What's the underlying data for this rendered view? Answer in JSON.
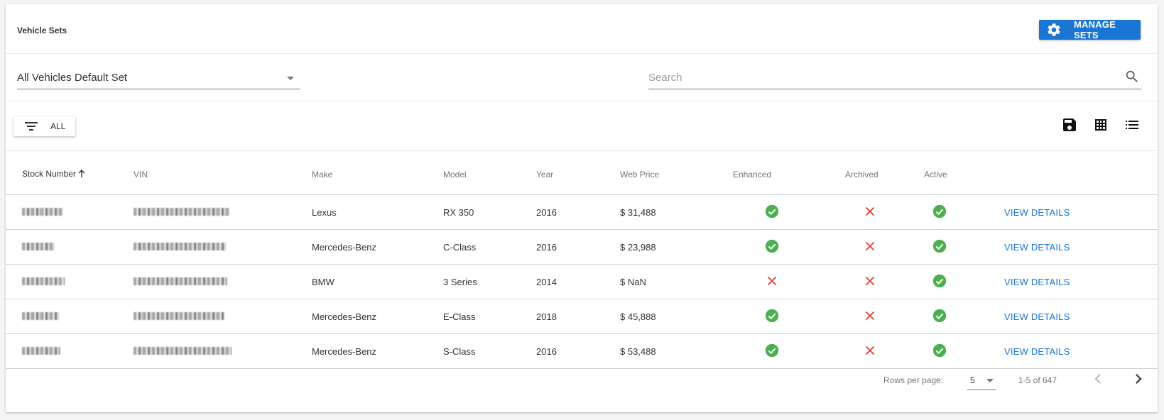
{
  "header": {
    "title": "Vehicle Sets",
    "manage_sets_label": "MANAGE SETS"
  },
  "controls": {
    "set_select_value": "All Vehicles Default Set",
    "search_placeholder": "Search",
    "filter_label": "ALL"
  },
  "table": {
    "columns": [
      "Stock Number",
      "VIN",
      "Make",
      "Model",
      "Year",
      "Web Price",
      "Enhanced",
      "Archived",
      "Active"
    ],
    "sort_column": "Stock Number",
    "sort_direction": "ascending",
    "rows": [
      {
        "make": "Lexus",
        "model": "RX 350",
        "year": "2016",
        "price": "$ 31,488",
        "enhanced": true,
        "archived": false,
        "active": true,
        "action": "VIEW DETAILS"
      },
      {
        "make": "Mercedes-Benz",
        "model": "C-Class",
        "year": "2016",
        "price": "$ 23,988",
        "enhanced": true,
        "archived": false,
        "active": true,
        "action": "VIEW DETAILS"
      },
      {
        "make": "BMW",
        "model": "3 Series",
        "year": "2014",
        "price": "$ NaN",
        "enhanced": false,
        "archived": false,
        "active": true,
        "action": "VIEW DETAILS"
      },
      {
        "make": "Mercedes-Benz",
        "model": "E-Class",
        "year": "2018",
        "price": "$ 45,888",
        "enhanced": true,
        "archived": false,
        "active": true,
        "action": "VIEW DETAILS"
      },
      {
        "make": "Mercedes-Benz",
        "model": "S-Class",
        "year": "2016",
        "price": "$ 53,488",
        "enhanced": true,
        "archived": false,
        "active": true,
        "action": "VIEW DETAILS"
      }
    ]
  },
  "pagination": {
    "rows_per_page_label": "Rows per page:",
    "rows_per_page": "5",
    "range": "1-5 of 647"
  },
  "colors": {
    "primary": "#1976d2",
    "success": "#4caf50",
    "danger": "#e53935"
  },
  "icons": {
    "manage": "gear-icon",
    "search": "search-icon",
    "filter": "filter-list-icon",
    "save": "save-icon",
    "grid": "grid-view-icon",
    "list": "list-view-icon",
    "check": "check-circle-icon",
    "cross": "close-icon",
    "prev": "chevron-left-icon",
    "next": "chevron-right-icon"
  }
}
